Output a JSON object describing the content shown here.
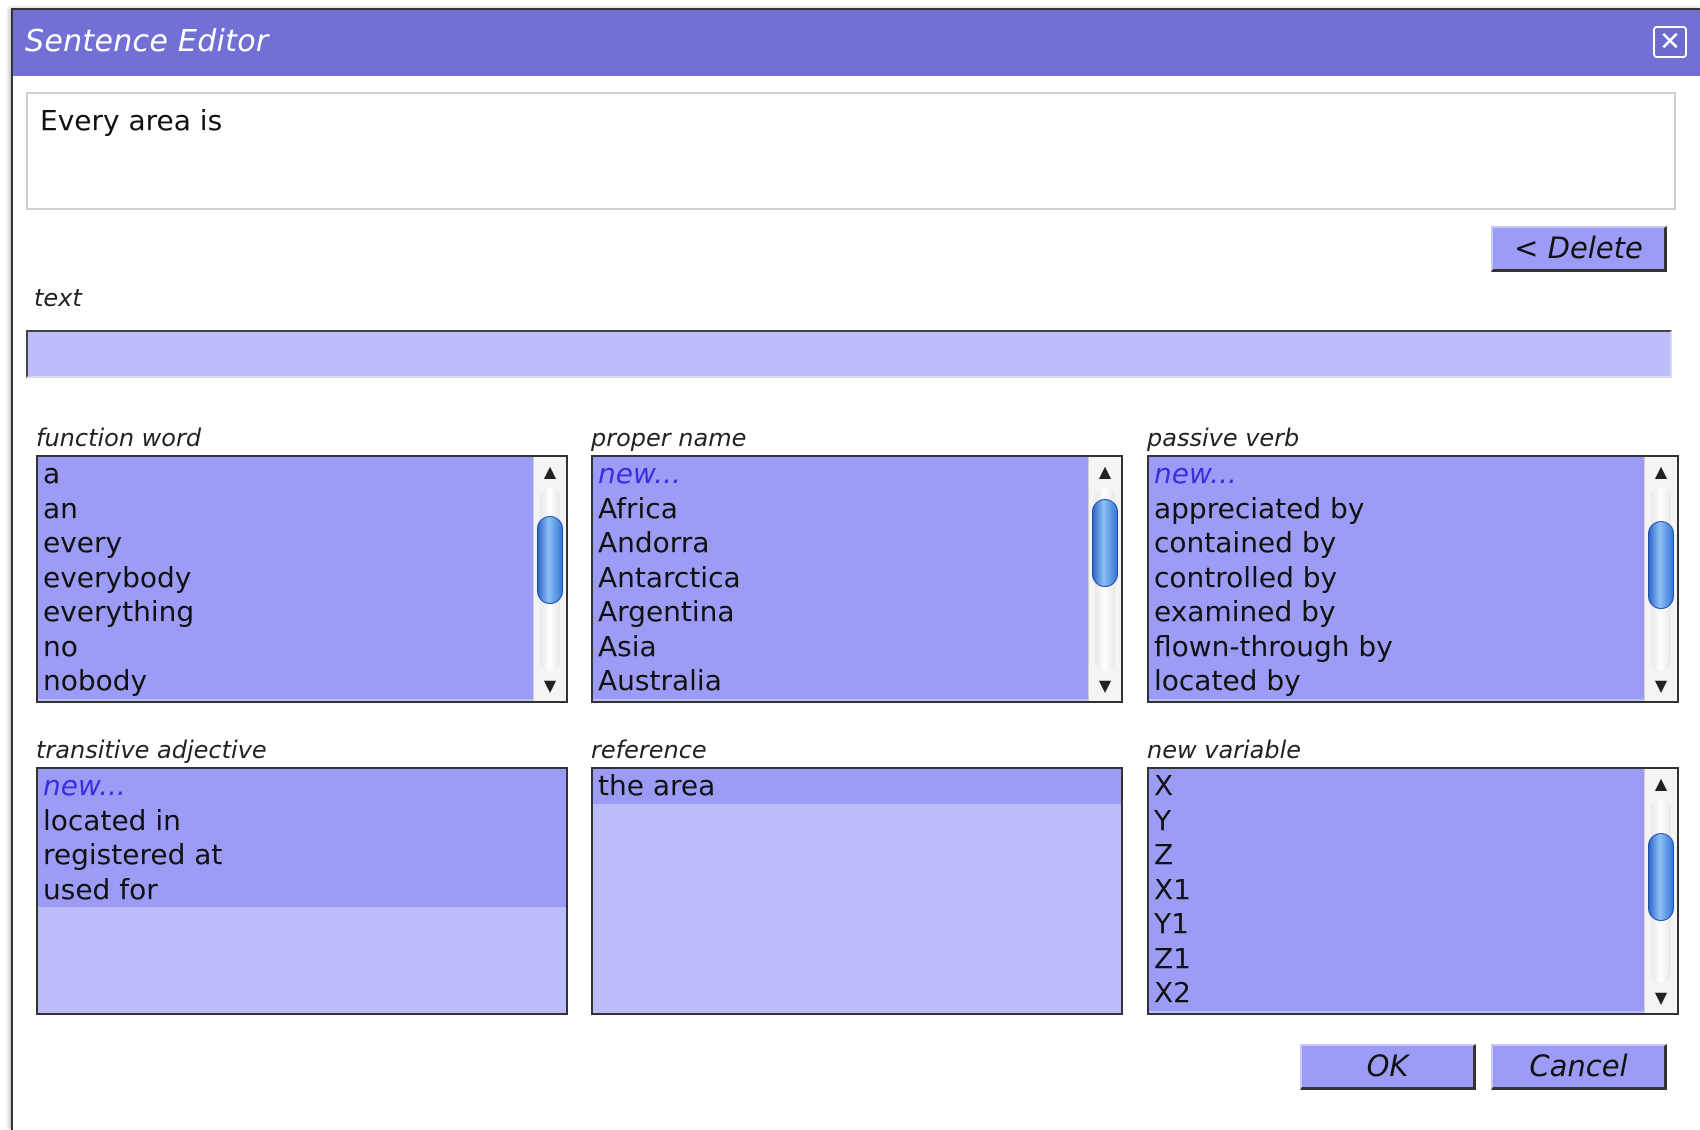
{
  "dialog": {
    "title": "Sentence Editor",
    "close_glyph": "✕",
    "sentence": "Every area is",
    "delete_label": "< Delete",
    "ok_label": "OK",
    "cancel_label": "Cancel"
  },
  "text_field": {
    "label": "text",
    "value": ""
  },
  "lists": {
    "function_word": {
      "label": "function word",
      "items": [
        "a",
        "an",
        "every",
        "everybody",
        "everything",
        "no",
        "nobody"
      ],
      "scroll_fraction": 0.3
    },
    "proper_name": {
      "label": "proper name",
      "items": [
        "new...",
        "Africa",
        "Andorra",
        "Antarctica",
        "Argentina",
        "Asia",
        "Australia"
      ],
      "scroll_fraction": 0.12
    },
    "passive_verb": {
      "label": "passive verb",
      "items": [
        "new...",
        "appreciated by",
        "contained by",
        "controlled by",
        "examined by",
        "flown-through by",
        "located by"
      ],
      "scroll_fraction": 0.35
    },
    "transitive_adjective": {
      "label": "transitive adjective",
      "items": [
        "new...",
        "located in",
        "registered at",
        "used for"
      ]
    },
    "reference": {
      "label": "reference",
      "items": [
        "the area"
      ]
    },
    "new_variable": {
      "label": "new variable",
      "items": [
        "X",
        "Y",
        "Z",
        "X1",
        "Y1",
        "Z1",
        "X2"
      ],
      "scroll_fraction": 0.35
    }
  },
  "colors": {
    "titlebar": "#7270d4",
    "list_background": "#bdbdfb",
    "list_item": "#9c9cf6",
    "new_item_text": "#3a2fe0",
    "button": "#9c9cf6"
  },
  "icons": {
    "close": "close-icon",
    "scroll_up": "scroll-up-arrow-icon",
    "scroll_down": "scroll-down-arrow-icon"
  }
}
